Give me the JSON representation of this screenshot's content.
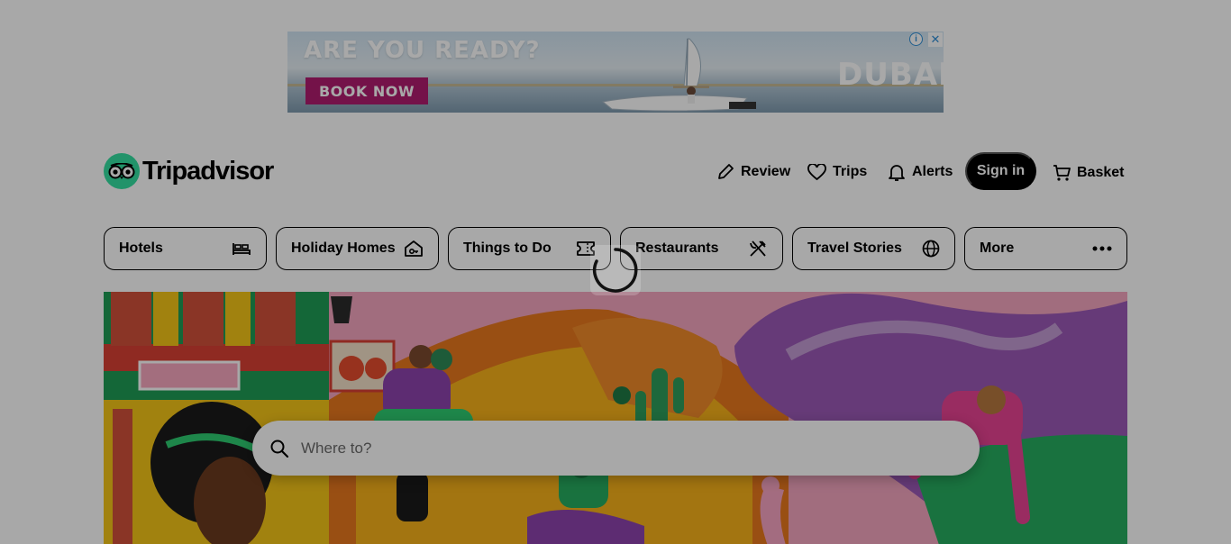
{
  "ad": {
    "headline": "ARE YOU READY?",
    "cta_label": "BOOK NOW",
    "brand": "DUBAI",
    "info_icon": "info-icon",
    "close_icon": "close-icon",
    "colors": {
      "cta": "#b01c6f",
      "sky": "#cfe3f2"
    }
  },
  "header": {
    "logo_text": "Tripadvisor",
    "logo_color": "#34e0a1",
    "nav": [
      {
        "label": "Review",
        "icon": "pencil-icon"
      },
      {
        "label": "Trips",
        "icon": "heart-icon"
      },
      {
        "label": "Alerts",
        "icon": "bell-icon"
      }
    ],
    "signin_label": "Sign in",
    "basket_label": "Basket",
    "basket_icon": "cart-icon"
  },
  "categories": [
    {
      "label": "Hotels",
      "icon": "bed-icon"
    },
    {
      "label": "Holiday Homes",
      "icon": "house-key-icon"
    },
    {
      "label": "Things to Do",
      "icon": "ticket-icon"
    },
    {
      "label": "Restaurants",
      "icon": "fork-knife-icon"
    },
    {
      "label": "Travel Stories",
      "icon": "globe-icon"
    },
    {
      "label": "More",
      "icon": "more-dots-icon"
    }
  ],
  "search": {
    "placeholder": "Where to?",
    "icon": "search-icon"
  },
  "overlay": {
    "state": "loading",
    "icon": "spinner-icon"
  }
}
